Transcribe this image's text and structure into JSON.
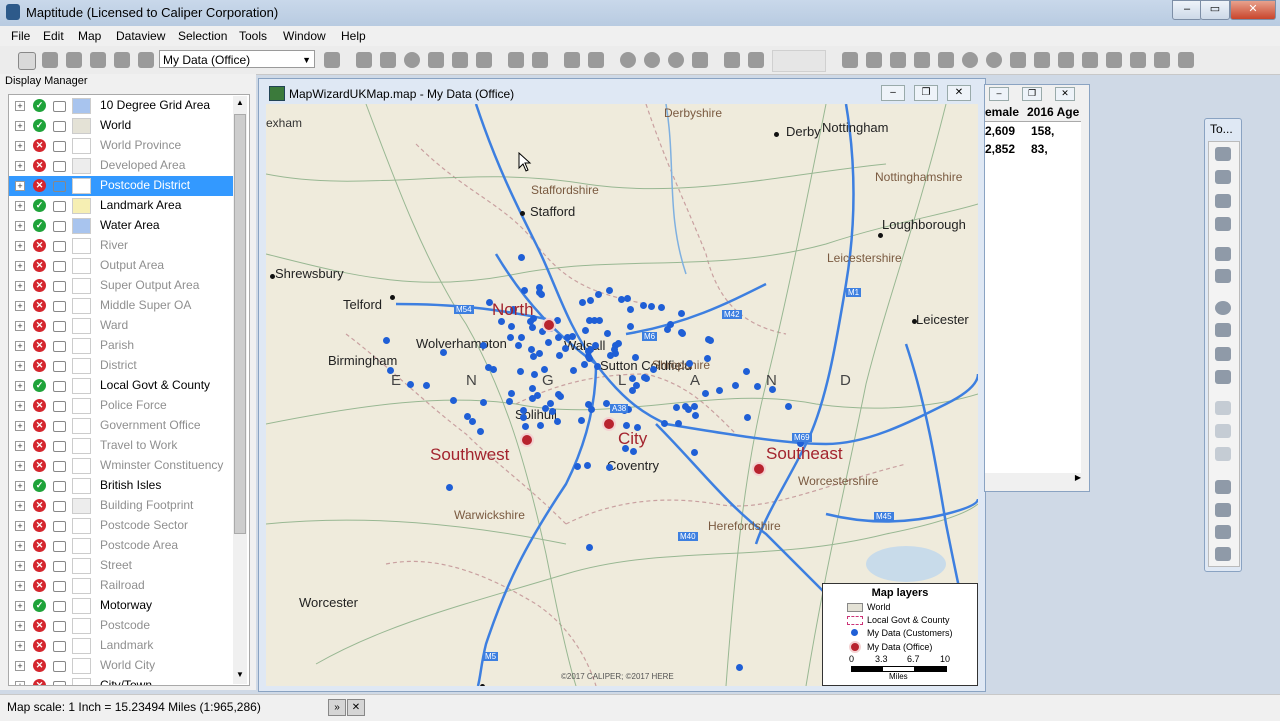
{
  "app": {
    "title": "Maptitude (Licensed to Caliper Corporation)"
  },
  "menu": [
    "File",
    "Edit",
    "Map",
    "Dataview",
    "Selection",
    "Tools",
    "Window",
    "Help"
  ],
  "toolbar": {
    "layer_select": "My Data (Office)"
  },
  "display_manager": {
    "title": "Display Manager",
    "layers": [
      {
        "name": "10 Degree Grid Area",
        "visible": true,
        "dim": false,
        "swatch": "#a8c4ee"
      },
      {
        "name": "World",
        "visible": true,
        "dim": false,
        "swatch": "#e4e2d6"
      },
      {
        "name": "World Province",
        "visible": false,
        "dim": true,
        "swatch": "#ffffff"
      },
      {
        "name": "Developed Area",
        "visible": false,
        "dim": true,
        "swatch": "#ededed"
      },
      {
        "name": "Postcode District",
        "visible": false,
        "dim": false,
        "swatch": "#ffffff",
        "selected": true
      },
      {
        "name": "Landmark Area",
        "visible": true,
        "dim": false,
        "swatch": "#f6efb3"
      },
      {
        "name": "Water Area",
        "visible": true,
        "dim": false,
        "swatch": "#a8c4ee"
      },
      {
        "name": "River",
        "visible": false,
        "dim": true,
        "swatch": "#ffffff"
      },
      {
        "name": "Output Area",
        "visible": false,
        "dim": true,
        "swatch": "#ffffff"
      },
      {
        "name": "Super Output Area",
        "visible": false,
        "dim": true,
        "swatch": "#ffffff"
      },
      {
        "name": "Middle Super OA",
        "visible": false,
        "dim": true,
        "swatch": "#ffffff"
      },
      {
        "name": "Ward",
        "visible": false,
        "dim": true,
        "swatch": "#ffffff"
      },
      {
        "name": "Parish",
        "visible": false,
        "dim": true,
        "swatch": "#ffffff"
      },
      {
        "name": "District",
        "visible": false,
        "dim": true,
        "swatch": "#ffffff"
      },
      {
        "name": "Local Govt & County",
        "visible": true,
        "dim": false,
        "swatch": "#ffffff"
      },
      {
        "name": "Police Force",
        "visible": false,
        "dim": true,
        "swatch": "#ffffff"
      },
      {
        "name": "Government Office",
        "visible": false,
        "dim": true,
        "swatch": "#ffffff"
      },
      {
        "name": "Travel to Work",
        "visible": false,
        "dim": true,
        "swatch": "#ffffff"
      },
      {
        "name": "Wminster Constituency",
        "visible": false,
        "dim": true,
        "swatch": "#ffffff"
      },
      {
        "name": "British Isles",
        "visible": true,
        "dim": false,
        "swatch": "#ffffff"
      },
      {
        "name": "Building Footprint",
        "visible": false,
        "dim": true,
        "swatch": "#ededed"
      },
      {
        "name": "Postcode Sector",
        "visible": false,
        "dim": true,
        "swatch": "#ffffff"
      },
      {
        "name": "Postcode Area",
        "visible": false,
        "dim": true,
        "swatch": "#ffffff"
      },
      {
        "name": "Street",
        "visible": false,
        "dim": true,
        "swatch": "#ffffff"
      },
      {
        "name": "Railroad",
        "visible": false,
        "dim": true,
        "swatch": "#ffffff"
      },
      {
        "name": "Motorway",
        "visible": true,
        "dim": false,
        "swatch": "#ffffff"
      },
      {
        "name": "Postcode",
        "visible": false,
        "dim": true,
        "swatch": "#ffffff"
      },
      {
        "name": "Landmark",
        "visible": false,
        "dim": true,
        "swatch": "#ffffff"
      },
      {
        "name": "World City",
        "visible": false,
        "dim": true,
        "swatch": "#ffffff"
      },
      {
        "name": "City/Town",
        "visible": false,
        "dim": false,
        "swatch": "#ffffff"
      }
    ]
  },
  "map_window": {
    "title": "MapWizardUKMap.map - My Data (Office)",
    "cities": [
      {
        "name": "Derbyshire",
        "type": "region"
      },
      {
        "name": "Derby",
        "type": "city"
      },
      {
        "name": "Nottingham",
        "type": "city"
      },
      {
        "name": "Nottinghamshire",
        "type": "region"
      },
      {
        "name": "Staffordshire",
        "type": "region"
      },
      {
        "name": "Stafford",
        "type": "city"
      },
      {
        "name": "Loughborough",
        "type": "city"
      },
      {
        "name": "Shrewsbury",
        "type": "city"
      },
      {
        "name": "Leicestershire",
        "type": "region"
      },
      {
        "name": "Telford",
        "type": "city"
      },
      {
        "name": "Leicester",
        "type": "city"
      },
      {
        "name": "Wolverhampton",
        "type": "city"
      },
      {
        "name": "Walsall",
        "type": "city"
      },
      {
        "name": "Sutton Coldfield",
        "type": "city"
      },
      {
        "name": "Shropshire",
        "type": "region"
      },
      {
        "name": "Birmingham",
        "type": "city"
      },
      {
        "name": "Solihull",
        "type": "city"
      },
      {
        "name": "Coventry",
        "type": "city"
      },
      {
        "name": "Worcestershire",
        "type": "region"
      },
      {
        "name": "Warwickshire",
        "type": "region"
      },
      {
        "name": "Herefordshire",
        "type": "region"
      },
      {
        "name": "Worcester",
        "type": "city"
      }
    ],
    "offices": [
      "North",
      "Southwest",
      "City",
      "Southeast"
    ],
    "country_label": [
      "E",
      "N",
      "G",
      "L",
      "A",
      "N",
      "D"
    ],
    "road_labels": [
      "M54",
      "M6",
      "M42",
      "M1",
      "A38",
      "M69",
      "M45",
      "M40",
      "M5"
    ],
    "copyright": "©2017 CALIPER; ©2017 HERE",
    "edge_label": "exham"
  },
  "legend": {
    "title": "Map layers",
    "items": [
      "World",
      "Local Govt & County",
      "My Data (Customers)",
      "My Data (Office)"
    ],
    "scale_ticks": [
      "0",
      "3.3",
      "6.7",
      "10"
    ],
    "scale_unit": "Miles"
  },
  "dataview": {
    "headers": [
      "emale",
      "2016 Age"
    ],
    "rows": [
      [
        "2,609",
        "158,"
      ],
      [
        "2,852",
        "83,"
      ]
    ]
  },
  "tools": {
    "title": "To..."
  },
  "status": {
    "scale": "Map scale: 1 Inch = 15.23494 Miles (1:965,286)"
  },
  "colors": {
    "accent": "#3399ff",
    "customer": "#1f5fd6",
    "office": "#b8232e",
    "motorway": "#3d7fe0"
  }
}
